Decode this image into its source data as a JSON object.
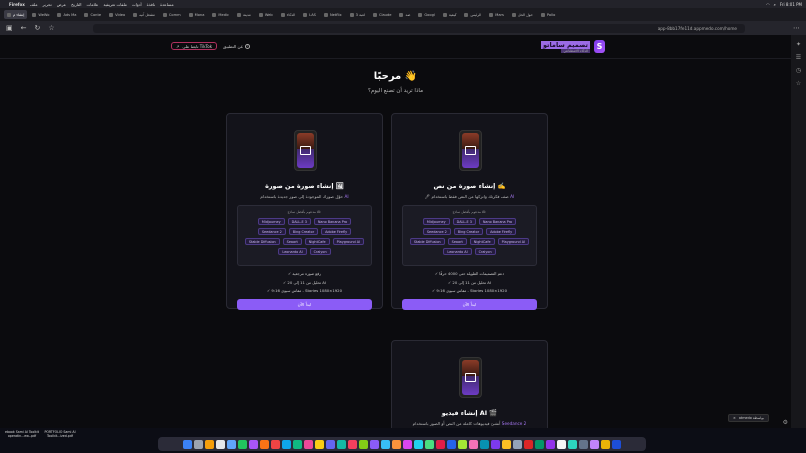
{
  "menubar": {
    "app": "Firefox",
    "items": [
      "ملف",
      "تحرير",
      "عرض",
      "التاريخ",
      "علامات",
      "ملفات تعريفية",
      "أدوات",
      "نافذة",
      "مساعدة"
    ],
    "clock": "Fri 8:01 PM"
  },
  "tabs": [
    {
      "label": "إنشاء م",
      "active": true
    },
    {
      "label": "WeWo"
    },
    {
      "label": "Ads Ma"
    },
    {
      "label": "Conte"
    },
    {
      "label": "Video"
    },
    {
      "label": "مشغل آنيه"
    },
    {
      "label": "Comm"
    },
    {
      "label": "Mona"
    },
    {
      "label": "Medic"
    },
    {
      "label": "مدينة"
    },
    {
      "label": "Web"
    },
    {
      "label": "الذكاء"
    },
    {
      "label": "LAS"
    },
    {
      "label": "Netflix"
    },
    {
      "label": "لعبة 3"
    },
    {
      "label": "Claude"
    },
    {
      "label": "ضد"
    },
    {
      "label": "Googl"
    },
    {
      "label": "كيفية"
    },
    {
      "label": "الرئيس"
    },
    {
      "label": "Mars"
    },
    {
      "label": "حول الحل"
    },
    {
      "label": "Pollo"
    }
  ],
  "urlbar": {
    "url": "app-8bb17fe11d.appmedo.com/home"
  },
  "header": {
    "logo_letter": "S",
    "logo_title": "تصميم ساماتو",
    "logo_subtitle": "الذكاء الاصطناعي",
    "tiktok_button": "تابعنا على TikTok",
    "about_label": "عن التطبيق",
    "about_icon": "i"
  },
  "welcome": "مرحبًا 👋",
  "subtitle": "ماذا تريد أن تصنع اليوم؟",
  "cards": [
    {
      "title": "إنشاء صورة من نص ✍️",
      "desc_prefix": "🖊 صف فكرتك واتركها من النص فقط باستخدام",
      "desc_ai": "AI",
      "models_label": "مدعوم بأفضل نماذج AI:",
      "chips": [
        "Midjourney",
        "DALL-E 3",
        "Nano Banana Pro",
        "Seedance 2",
        "Bing Creator",
        "Adobe Firefly",
        "Stable Diffusion",
        "Seaart",
        "NightCafe",
        "Playground AI",
        "Leonardo AI",
        "Craiyon"
      ],
      "features": [
        "✓ دعم التصميمات الطويلة حتى 4000 حرفًا",
        "✓ تحليل من 11 إلى 20 AI",
        "✓ مقاس سيوي 9:16 - Stories 1080×1920"
      ],
      "cta": "ابدأ الآن"
    },
    {
      "title": "إنشاء صورة من صورة 🖼",
      "desc_prefix": "حوّل صورك الموجودة إلى صور جديدة باستخدام",
      "desc_ai": "AI",
      "models_label": "مدعوم بأفضل نماذج AI:",
      "chips": [
        "Midjourney",
        "DALL-E 3",
        "Nano Banana Pro",
        "Seedance 2",
        "Bing Creator",
        "Adobe Firefly",
        "Stable Diffusion",
        "Seaart",
        "NightCafe",
        "Playground AI",
        "Leonardo AI",
        "Craiyon"
      ],
      "features": [
        "✓ رفع صورة مرجعية",
        "✓ تحليل من 11 إلى 20 AI",
        "✓ مقاس سيوي 9:16 - Stories 1080×1920"
      ],
      "cta": "ابدأ الآن"
    },
    {
      "title": "إنشاء فيديو AI 🎬",
      "desc_prefix": "أنشئ فيديوهات كاملة من النص أو الصور باستخدام",
      "desc_ai": "Seedance 2",
      "models_label": "",
      "chips": [],
      "features": [],
      "cta": ""
    }
  ],
  "toast": "atmedo بواسطة",
  "desktop_files": [
    {
      "name": "ebook Sami AI Toolkit operatin...ew-.pdf"
    },
    {
      "name": "PORTFOLIO Sami AI Toolkit...ized.pdf"
    }
  ],
  "colors": {
    "accent": "#8b5cf6",
    "chip_border": "#4c3a86",
    "background": "#0b0b0e",
    "tiktok_border": "#b0315e"
  }
}
